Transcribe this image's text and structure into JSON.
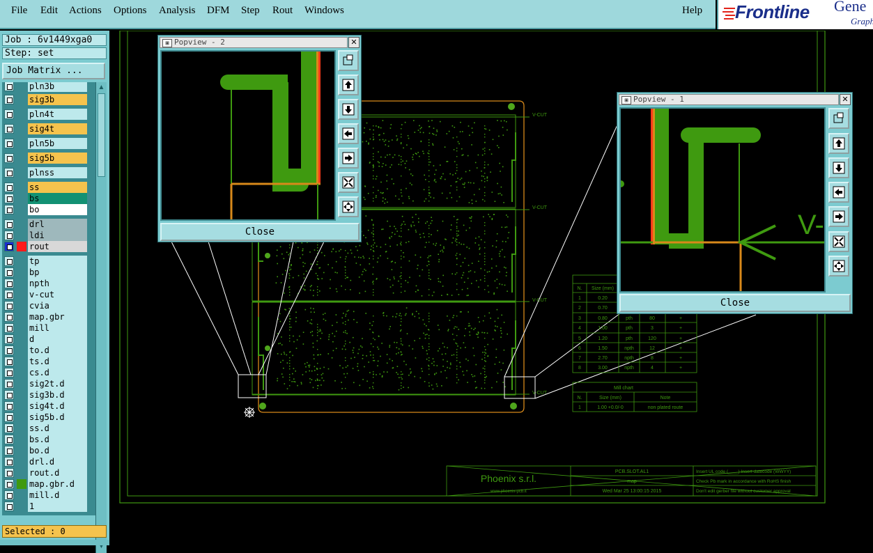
{
  "menu": {
    "file": "File",
    "edit": "Edit",
    "actions": "Actions",
    "options": "Options",
    "analysis": "Analysis",
    "dfm": "DFM",
    "step": "Step",
    "rout": "Rout",
    "windows": "Windows",
    "help": "Help"
  },
  "logo": {
    "brand": "Frontline",
    "product_fragment": "Gene",
    "subtitle_fragment": "Graph"
  },
  "left_panel": {
    "job": "Job : 6v1449xga0",
    "step": "Step: set",
    "job_matrix_button": "Job Matrix ...",
    "selected": "Selected : 0",
    "layers": [
      {
        "name": "pln3b",
        "kind": "plain"
      },
      {
        "name": "sig3b",
        "kind": "signal"
      },
      {
        "name": "pln4t",
        "kind": "plain"
      },
      {
        "name": "sig4t",
        "kind": "signal"
      },
      {
        "name": "pln5b",
        "kind": "plain"
      },
      {
        "name": "sig5b",
        "kind": "signal"
      },
      {
        "name": "plnss",
        "kind": "plain"
      },
      {
        "name": "ss",
        "kind": "signal"
      },
      {
        "name": "bs",
        "kind": "bs"
      },
      {
        "name": "bo",
        "kind": "bo"
      },
      {
        "name": "drl",
        "kind": "drl"
      },
      {
        "name": "ldi",
        "kind": "drl"
      },
      {
        "name": "rout",
        "kind": "rout"
      },
      {
        "name": "tp",
        "kind": "plain"
      },
      {
        "name": "bp",
        "kind": "plain"
      },
      {
        "name": "npth",
        "kind": "plain"
      },
      {
        "name": "v-cut",
        "kind": "plain"
      },
      {
        "name": "cvia",
        "kind": "plain"
      },
      {
        "name": "map.gbr",
        "kind": "plain"
      },
      {
        "name": "mill",
        "kind": "plain"
      },
      {
        "name": "d",
        "kind": "plain"
      },
      {
        "name": "to.d",
        "kind": "plain"
      },
      {
        "name": "ts.d",
        "kind": "plain"
      },
      {
        "name": "cs.d",
        "kind": "plain"
      },
      {
        "name": "sig2t.d",
        "kind": "plain"
      },
      {
        "name": "sig3b.d",
        "kind": "plain"
      },
      {
        "name": "sig4t.d",
        "kind": "plain"
      },
      {
        "name": "sig5b.d",
        "kind": "plain"
      },
      {
        "name": "ss.d",
        "kind": "plain"
      },
      {
        "name": "bs.d",
        "kind": "plain"
      },
      {
        "name": "bo.d",
        "kind": "plain"
      },
      {
        "name": "drl.d",
        "kind": "plain"
      },
      {
        "name": "rout.d",
        "kind": "plain"
      },
      {
        "name": "map.gbr.d",
        "kind": "plain"
      },
      {
        "name": "mill.d",
        "kind": "plain"
      },
      {
        "name": "1",
        "kind": "plain"
      }
    ]
  },
  "popview2": {
    "title": "Popview - 2",
    "close": "Close"
  },
  "popview1": {
    "title": "Popview - 1",
    "close": "Close",
    "view_text": "V-"
  },
  "board": {
    "vcut_label": "V-CUT"
  },
  "drill_table": {
    "headers": [
      "N.",
      "Size (mm)",
      "",
      "",
      ""
    ],
    "rows": [
      [
        "1",
        "0.20",
        "",
        "",
        ""
      ],
      [
        "2",
        "0.70",
        "",
        "",
        ""
      ],
      [
        "3",
        "0.80",
        "pth",
        "80",
        "+"
      ],
      [
        "4",
        "1.00",
        "pth",
        "3",
        "+"
      ],
      [
        "5",
        "1.20",
        "pth",
        "120",
        "+"
      ],
      [
        "6",
        "1.50",
        "npth",
        "12",
        "+"
      ],
      [
        "7",
        "2.70",
        "npth",
        "8",
        "+"
      ],
      [
        "8",
        "3.00",
        "npth",
        "4",
        "+"
      ]
    ]
  },
  "mill_table": {
    "title": "Mill chart",
    "headers": [
      "N.",
      "Size (mm)",
      "Note"
    ],
    "rows": [
      [
        "1",
        "1.00  +0.0/-0",
        "non plated route"
      ]
    ]
  },
  "title_block": {
    "company": "Phoenix s.r.l.",
    "website": "www.phoenix-pcb.it",
    "part": "PCB.SLOT.AL1",
    "layer": "map",
    "date": "Wed Mar 25 13:00:15 2015",
    "note1": "Insert UL code (____)   Insert datecode (WWYY)",
    "note2": "Check Pb mark in accordance with RoHS finish",
    "note3": "Don't edit gerber file without customer approval"
  },
  "colors": {
    "menu_bg": "#9ed8dc",
    "panel_bg": "#7ccbd0",
    "signal_layer": "#f5c34d",
    "board_green": "#4fa61c",
    "trace_green": "#3f9a10",
    "outline_orange": "#d8891a",
    "copper_red": "#ff3a1a"
  },
  "icons": [
    "zoom-fit-icon",
    "pan-up-icon",
    "pan-down-icon",
    "pan-left-icon",
    "pan-right-icon",
    "zoom-out-icon",
    "zoom-in-icon",
    "crosshair-icon"
  ]
}
